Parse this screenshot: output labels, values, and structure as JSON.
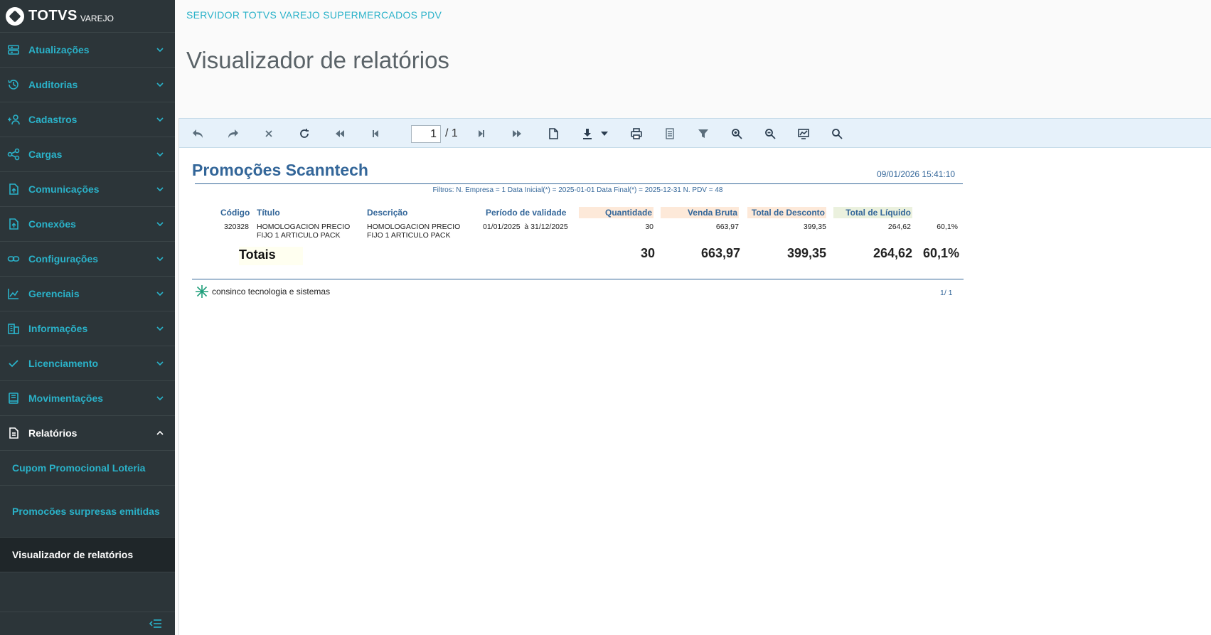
{
  "brand": {
    "name": "TOTVS",
    "sub": "VAREJO"
  },
  "sidebar": {
    "items": [
      {
        "label": "Atualizações",
        "icon": "server-icon"
      },
      {
        "label": "Auditorias",
        "icon": "history-icon"
      },
      {
        "label": "Cadastros",
        "icon": "add-user-icon"
      },
      {
        "label": "Cargas",
        "icon": "share-icon"
      },
      {
        "label": "Comunicações",
        "icon": "file-upload-icon"
      },
      {
        "label": "Conexões",
        "icon": "file-upload-icon"
      },
      {
        "label": "Configurações",
        "icon": "link-icon"
      },
      {
        "label": "Gerenciais",
        "icon": "chart-icon"
      },
      {
        "label": "Informações",
        "icon": "building-icon"
      },
      {
        "label": "Licenciamento",
        "icon": "check-icon"
      },
      {
        "label": "Movimentações",
        "icon": "book-icon"
      },
      {
        "label": "Relatórios",
        "icon": "document-icon"
      }
    ],
    "subitems": [
      {
        "label": "Cupom Promocional Loteria"
      },
      {
        "label": "Promocões surpresas emitidas"
      },
      {
        "label": "Visualizador de relatórios"
      }
    ]
  },
  "header": {
    "server": "SERVIDOR TOTVS VAREJO SUPERMERCADOS PDV",
    "title": "Visualizador de relatórios"
  },
  "toolbar": {
    "page_current": "1",
    "page_total": "/ 1"
  },
  "report": {
    "title": "Promoções Scanntech",
    "datetime": "09/01/2026 15:41:10",
    "filters": "Filtros:  N. Empresa = 1 Data Inicial(*) = 2025-01-01 Data Final(*) = 2025-12-31 N. PDV = 48",
    "columns": {
      "codigo": "Código",
      "titulo": "Título",
      "descricao": "Descrição",
      "periodo": "Período de validade",
      "quantidade": "Quantidade",
      "venda_bruta": "Venda Bruta",
      "total_desconto": "Total de Desconto",
      "total_liquido": "Total de Líquido"
    },
    "row": {
      "codigo": "320328",
      "titulo_l1": "HOMOLOGACION PRECIO",
      "titulo_l2": "FIJO 1 ARTICULO PACK",
      "descricao_l1": "HOMOLOGACION PRECIO",
      "descricao_l2": "FIJO 1 ARTICULO PACK",
      "periodo": "01/01/2025  à 31/12/2025",
      "quantidade": "30",
      "venda_bruta": "663,97",
      "total_desconto": "399,35",
      "total_liquido": "264,62",
      "percentual": "60,1%"
    },
    "totals": {
      "label": "Totais",
      "quantidade": "30",
      "venda_bruta": "663,97",
      "total_desconto": "399,35",
      "total_liquido": "264,62",
      "percentual": "60,1%"
    },
    "footer_brand": "consinco tecnologia e sistemas",
    "footer_page": "1/ 1"
  }
}
